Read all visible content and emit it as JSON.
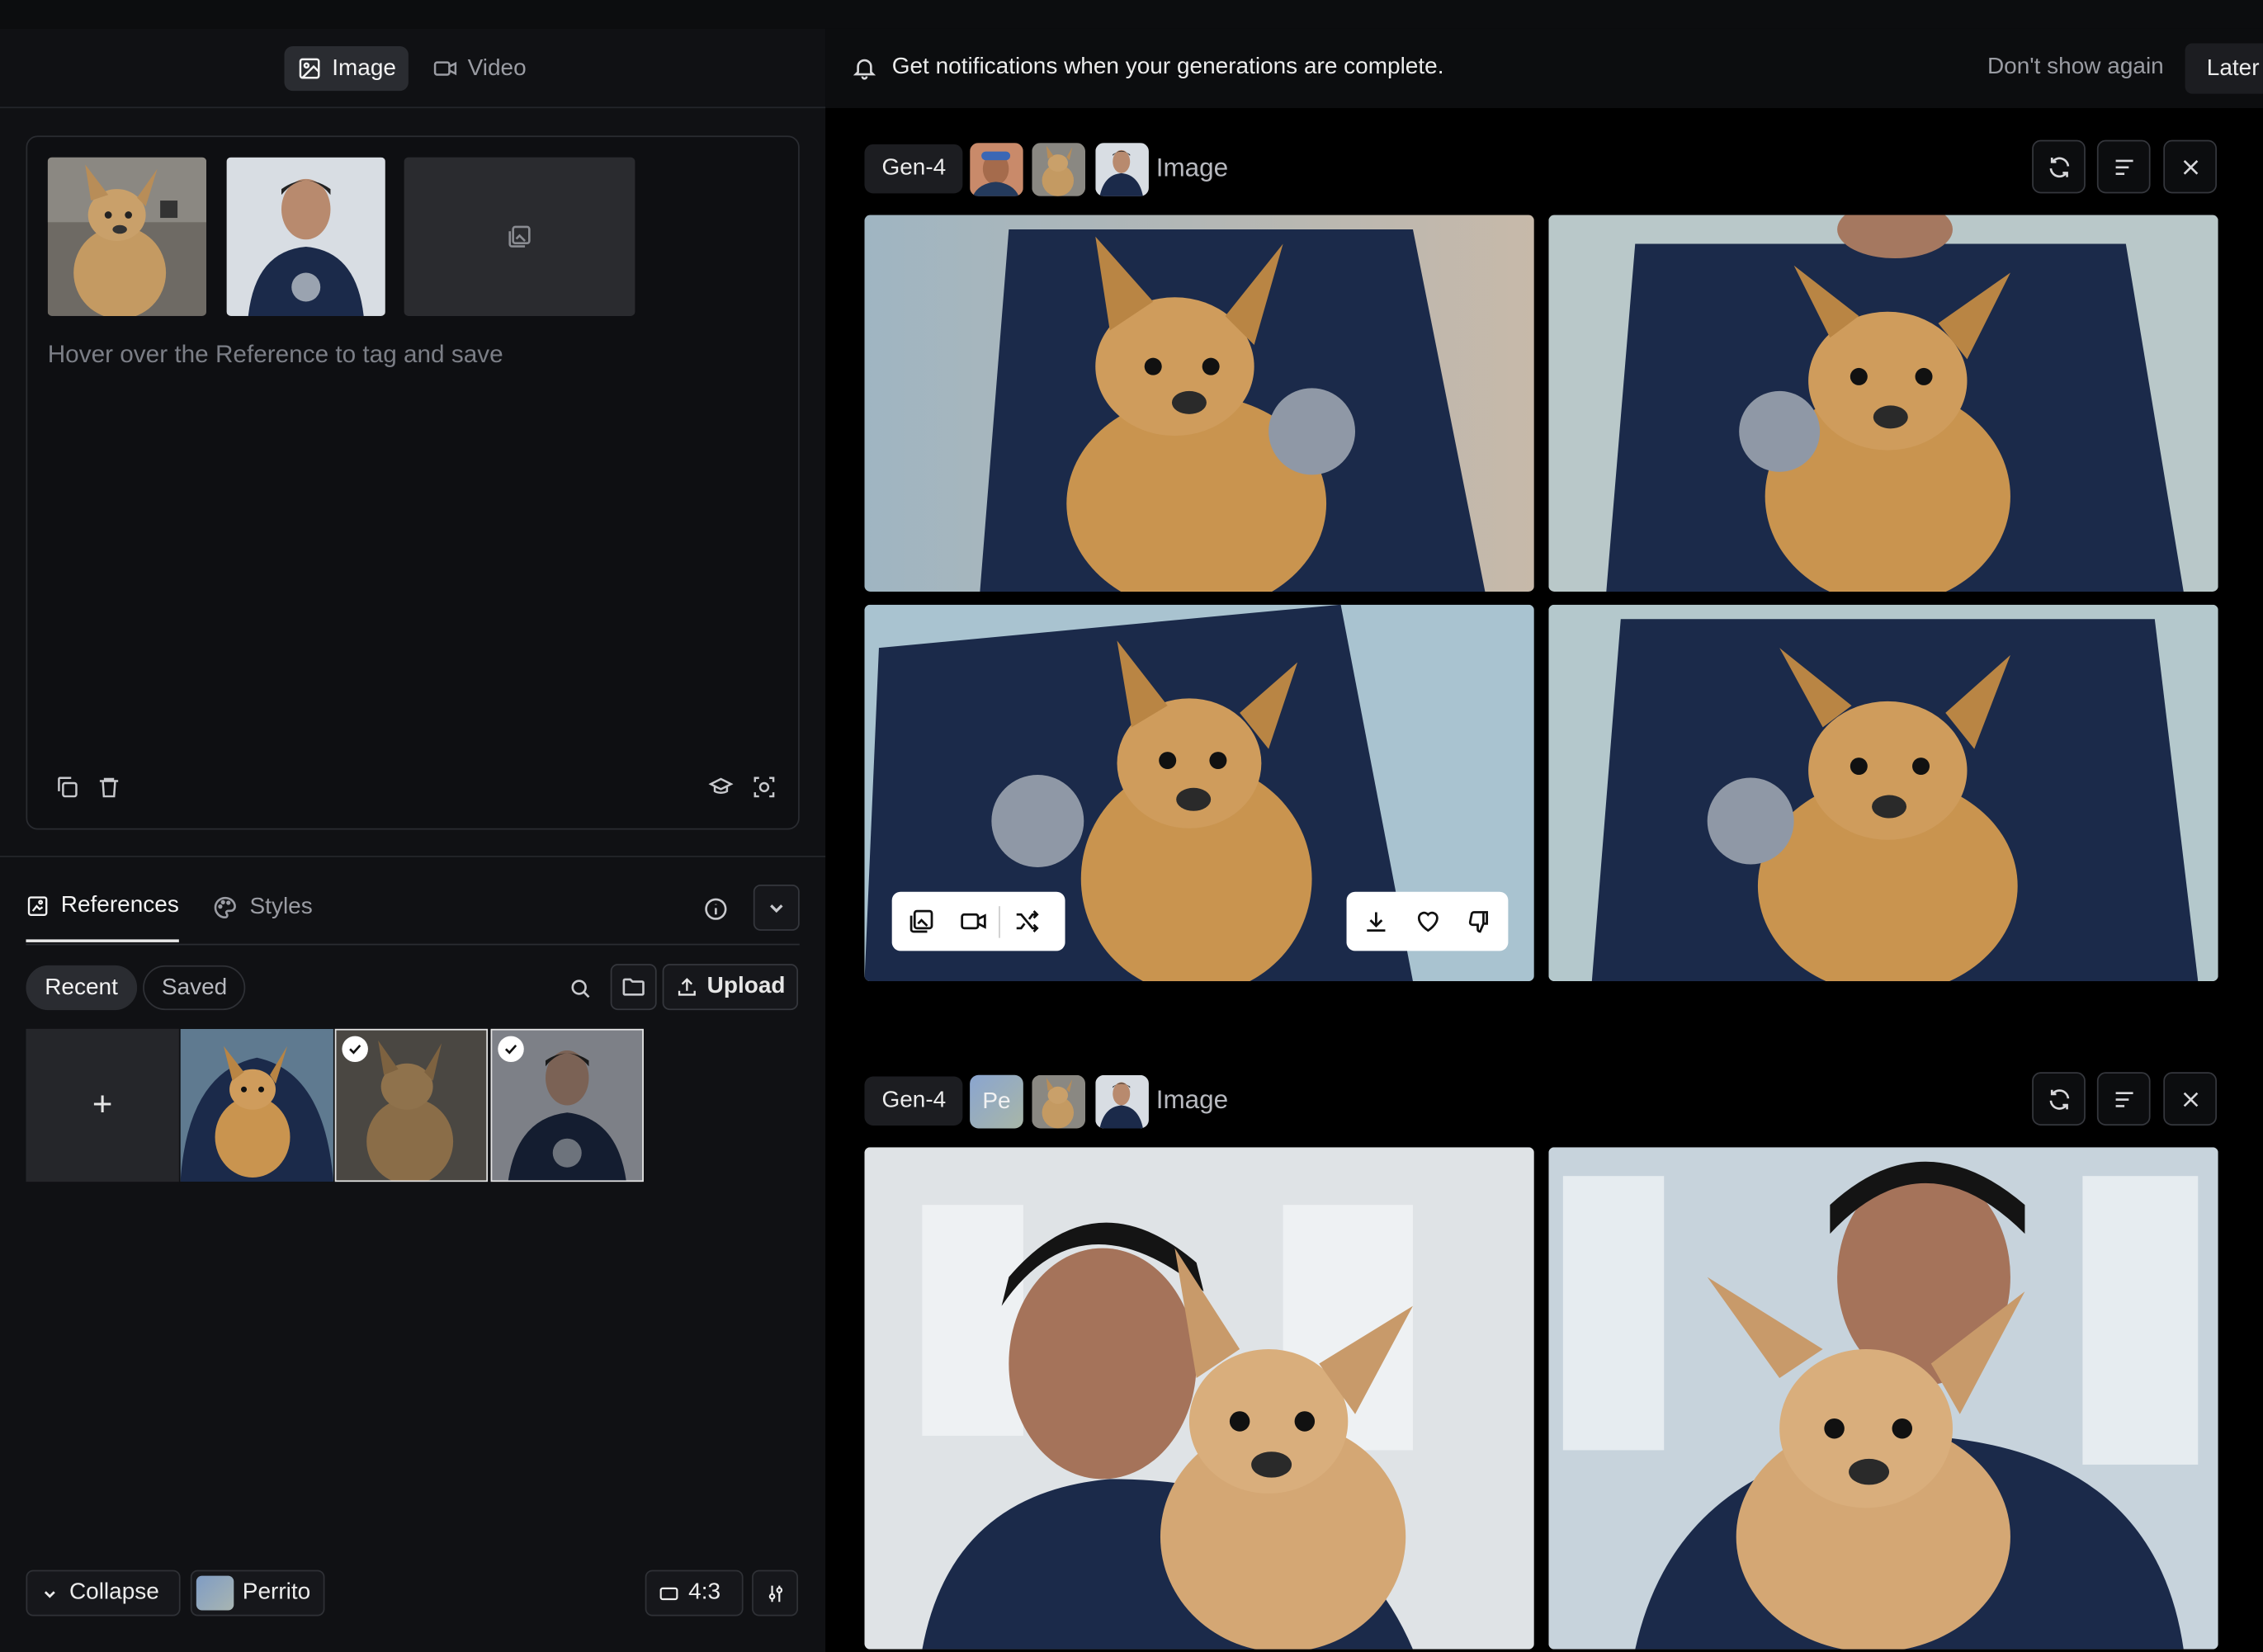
{
  "modes": {
    "image": "Image",
    "video": "Video"
  },
  "prompt": {
    "hint": "Hover over the Reference to tag and save"
  },
  "tabs": {
    "references": "References",
    "styles": "Styles"
  },
  "filters": {
    "recent": "Recent",
    "saved": "Saved"
  },
  "upload_label": "Upload",
  "add_label": "+",
  "bottom": {
    "collapse": "Collapse",
    "style_name": "Perrito",
    "aspect": "4:3"
  },
  "notification": {
    "message": "Get notifications when your generations are complete.",
    "dismiss": "Don't show again",
    "later": "Later"
  },
  "generations": [
    {
      "model": "Gen-4",
      "type": "Image"
    },
    {
      "model": "Gen-4",
      "avatar_text": "Pe",
      "type": "Image"
    }
  ],
  "icons": [
    "image-icon",
    "video-icon",
    "bell-icon",
    "copy-icon",
    "trash-icon",
    "graduation-cap-icon",
    "scan-icon",
    "info-icon",
    "chevron-down-icon",
    "search-icon",
    "folder-icon",
    "upload-icon",
    "check-icon",
    "aspect-ratio-icon",
    "settings-sliders-icon",
    "refresh-icon",
    "menu-lines-icon",
    "close-icon",
    "download-icon",
    "heart-icon",
    "thumbs-down-icon",
    "shuffle-icon",
    "image-reference-icon"
  ],
  "colors": {
    "panel": "#101114",
    "background": "#000000",
    "accent_chip": "#8aa5d0"
  }
}
